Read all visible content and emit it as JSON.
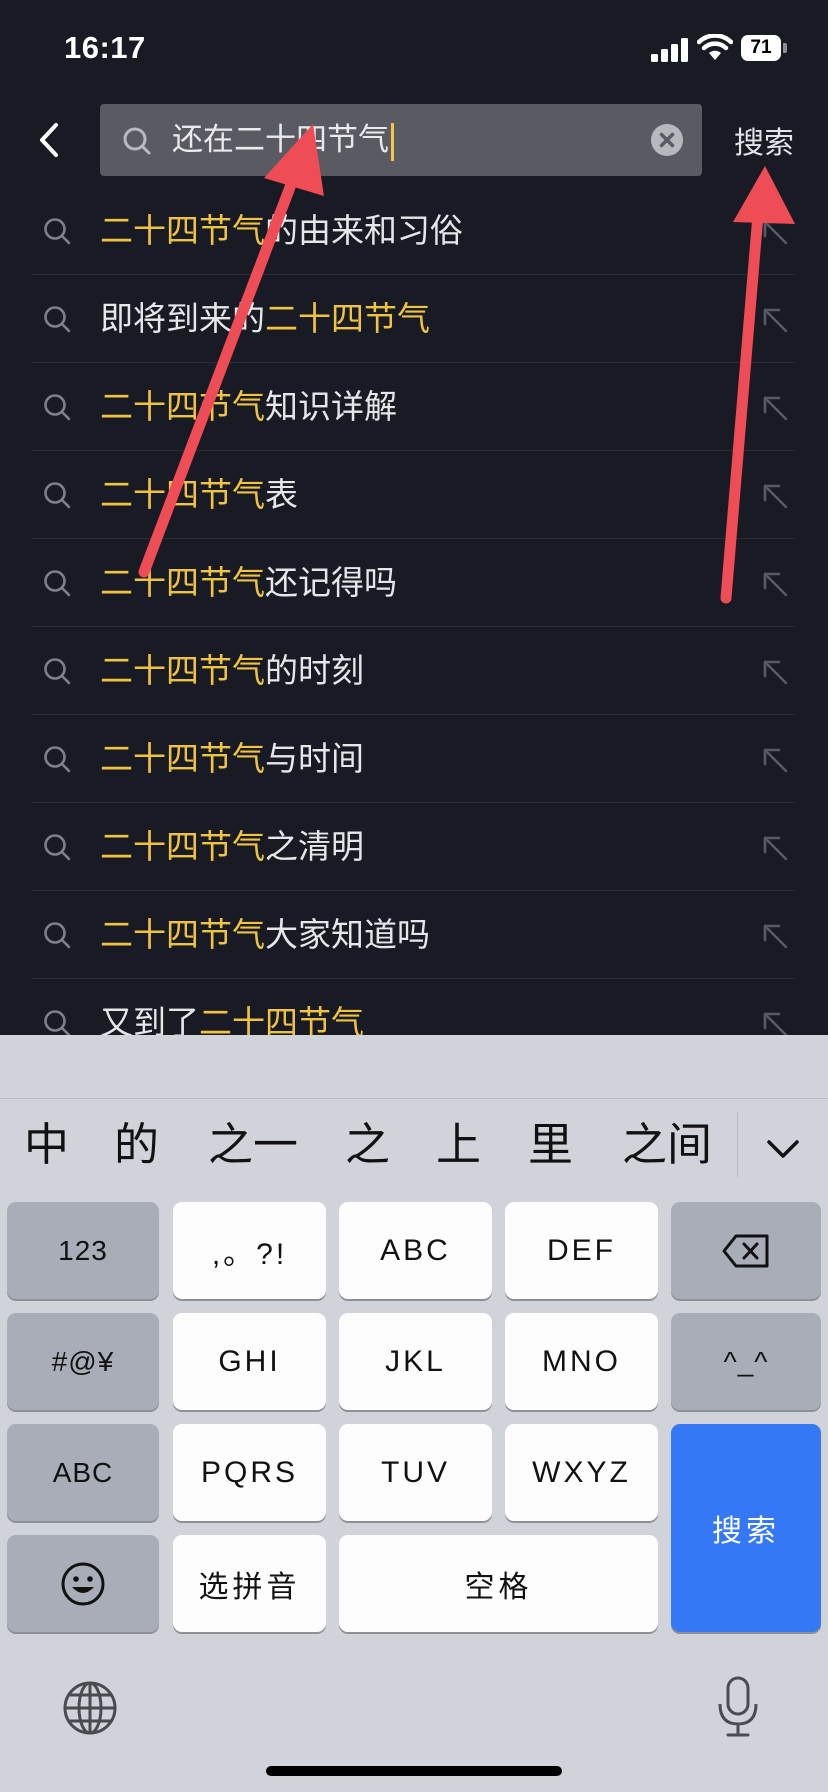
{
  "status": {
    "time": "16:17",
    "battery": "71"
  },
  "search": {
    "query": "还在二十四节气",
    "submit_label": "搜索"
  },
  "suggestions": [
    {
      "pre": "",
      "hl": "二十四节气",
      "post": "的由来和习俗"
    },
    {
      "pre": "即将到来的",
      "hl": "二十四节气",
      "post": ""
    },
    {
      "pre": "",
      "hl": "二十四节气",
      "post": "知识详解"
    },
    {
      "pre": "",
      "hl": "二十四节气",
      "post": "表"
    },
    {
      "pre": "",
      "hl": "二十四节气",
      "post": "还记得吗"
    },
    {
      "pre": "",
      "hl": "二十四节气",
      "post": "的时刻"
    },
    {
      "pre": "",
      "hl": "二十四节气",
      "post": "与时间"
    },
    {
      "pre": "",
      "hl": "二十四节气",
      "post": "之清明"
    },
    {
      "pre": "",
      "hl": "二十四节气",
      "post": "大家知道吗"
    },
    {
      "pre": "又到了",
      "hl": "二十四节气",
      "post": ""
    }
  ],
  "keyboard": {
    "candidates": [
      "中",
      "的",
      "之一",
      "之",
      "上",
      "里",
      "之间"
    ],
    "keys": {
      "num": "123",
      "punct": ",。?!",
      "abc": "ABC",
      "def": "DEF",
      "symbols": "#@¥",
      "ghi": "GHI",
      "jkl": "JKL",
      "mno": "MNO",
      "kaomoji": "^_^",
      "abc_mode": "ABC",
      "pqrs": "PQRS",
      "tuv": "TUV",
      "wxyz": "WXYZ",
      "search": "搜索",
      "select_pinyin": "选拼音",
      "space": "空格"
    }
  },
  "colors": {
    "background": "#181a24",
    "highlight": "#f0c341",
    "annotation_arrow": "#ef4d56",
    "keyboard_action": "#3578f6"
  },
  "icons": [
    "back-chevron-icon",
    "search-icon",
    "clear-icon",
    "fill-arrow-icon",
    "delete-icon",
    "emoji-icon",
    "globe-icon",
    "microphone-icon",
    "chevron-down-icon"
  ]
}
